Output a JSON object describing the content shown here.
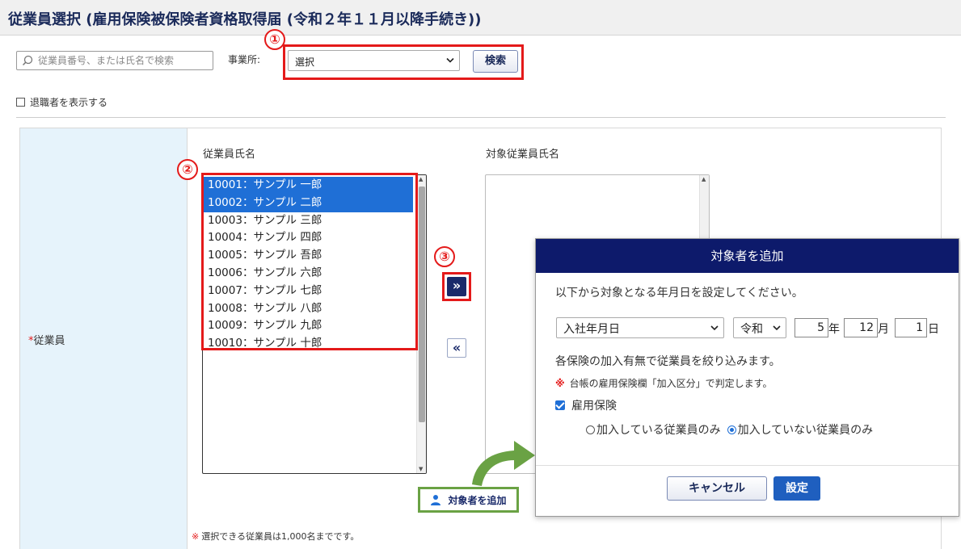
{
  "header": {
    "title": "従業員選択 (雇用保険被保険者資格取得届 (令和２年１１月以降手続き))"
  },
  "search": {
    "placeholder": "従業員番号、または氏名で検索",
    "value": ""
  },
  "office": {
    "label": "事業所:",
    "selected": "選択",
    "search_button": "検索"
  },
  "retired": {
    "label": "退職者を表示する",
    "checked": false
  },
  "form": {
    "field_label": "従業員",
    "required_mark": "*",
    "source_header": "従業員氏名",
    "target_header": "対象従業員氏名",
    "employees": [
      {
        "label": "10001：サンプル 一郎",
        "selected": true
      },
      {
        "label": "10002：サンプル 二郎",
        "selected": true
      },
      {
        "label": "10003：サンプル 三郎",
        "selected": false
      },
      {
        "label": "10004：サンプル 四郎",
        "selected": false
      },
      {
        "label": "10005：サンプル 吾郎",
        "selected": false
      },
      {
        "label": "10006：サンプル 六郎",
        "selected": false
      },
      {
        "label": "10007：サンプル 七郎",
        "selected": false
      },
      {
        "label": "10008：サンプル 八郎",
        "selected": false
      },
      {
        "label": "10009：サンプル 九郎",
        "selected": false
      },
      {
        "label": "10010：サンプル 十郎",
        "selected": false
      }
    ],
    "move_right": "»",
    "move_left": "«",
    "add_target_label": "対象者を追加",
    "note_mark": "※",
    "note": "選択できる従業員は1,000名までです。"
  },
  "callouts": [
    "①",
    "②",
    "③"
  ],
  "modal": {
    "title": "対象者を追加",
    "intro": "以下から対象となる年月日を設定してください。",
    "date_type": "入社年月日",
    "era": "令和",
    "year": "5",
    "year_unit": "年",
    "month": "12",
    "month_unit": "月",
    "day": "1",
    "day_unit": "日",
    "filter_text": "各保険の加入有無で従業員を絞り込みます。",
    "filter_note_mark": "※",
    "filter_note": "台帳の雇用保険欄「加入区分」で判定します。",
    "insurance_label": "雇用保険",
    "insurance_checked": true,
    "radio_joined": "加入している従業員のみ",
    "radio_not_joined": "加入していない従業員のみ",
    "radio_selected": "not_joined",
    "cancel_button": "キャンセル",
    "set_button": "設定"
  },
  "colors": {
    "header_navy": "#0d1a6b",
    "callout_red": "#e41a1a",
    "highlight_green": "#6aa244",
    "selection_blue": "#1f6fd6"
  }
}
